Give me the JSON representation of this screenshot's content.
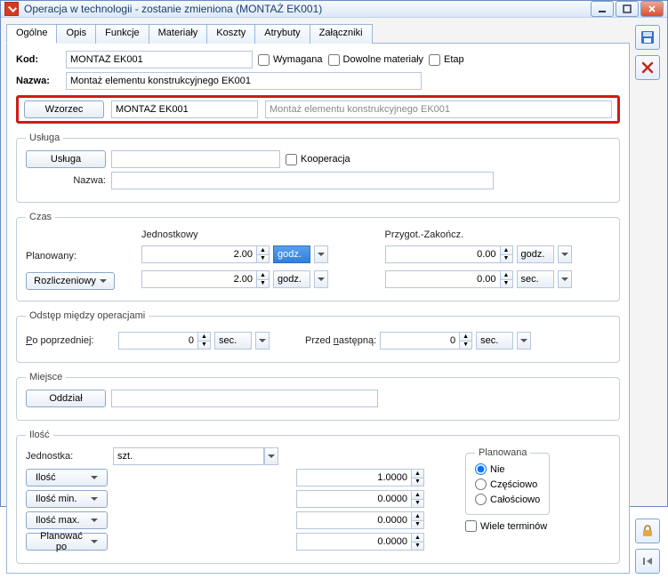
{
  "titlebar": {
    "title": "Operacja w technologii - zostanie zmieniona  (MONTAŻ EK001)"
  },
  "tabs": [
    "Ogólne",
    "Opis",
    "Funkcje",
    "Materiały",
    "Koszty",
    "Atrybuty",
    "Załączniki"
  ],
  "form": {
    "kod_label": "Kod:",
    "kod_value": "MONTAŻ EK001",
    "wymagana": "Wymagana",
    "dowolne": "Dowolne materiały",
    "etap": "Etap",
    "nazwa_label": "Nazwa:",
    "nazwa_value": "Montaż elementu konstrukcyjnego EK001"
  },
  "wzorzec": {
    "btn": "Wzorzec",
    "code": "MONTAŻ EK001",
    "desc": "Montaż elementu konstrukcyjnego EK001"
  },
  "usluga": {
    "legend": "Usługa",
    "btn": "Usługa",
    "koop": "Kooperacja",
    "nazwa_label": "Nazwa:"
  },
  "czas": {
    "legend": "Czas",
    "planowany": "Planowany:",
    "rozlicz": "Rozliczeniowy",
    "jedn": "Jednostkowy",
    "przyg": "Przygot.-Zakończ.",
    "v_j1": "2.00",
    "u_j1": "godz.",
    "v_p1": "0.00",
    "u_p1": "godz.",
    "v_j2": "2.00",
    "u_j2": "godz.",
    "v_p2": "0.00",
    "u_p2": "sec."
  },
  "odstep": {
    "legend": "Odstęp między operacjami",
    "po": "Po poprzedniej:",
    "po_v": "0",
    "po_u": "sec.",
    "przed": "Przed następną:",
    "przed_v": "0",
    "przed_u": "sec."
  },
  "miejsce": {
    "legend": "Miejsce",
    "oddzial": "Oddział"
  },
  "ilosc": {
    "legend": "Ilość",
    "jednostka": "Jednostka:",
    "jedn_v": "szt.",
    "ilosc": "Ilość",
    "ilosc_min": "Ilość min.",
    "ilosc_max": "Ilość max.",
    "plan_po": "Planować po",
    "v1": "1.0000",
    "v2": "0.0000",
    "v3": "0.0000",
    "v4": "0.0000",
    "planowana": "Planowana",
    "nie": "Nie",
    "czesc": "Częściowo",
    "calosc": "Całościowo",
    "wiele": "Wiele terminów"
  }
}
